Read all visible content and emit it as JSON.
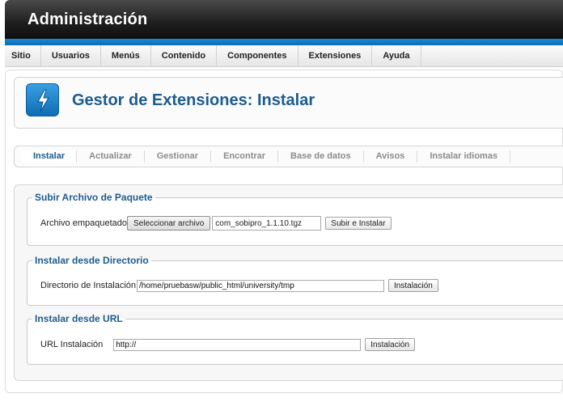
{
  "app": {
    "title": "Administración"
  },
  "menu": [
    "Sitio",
    "Usuarios",
    "Menús",
    "Contenido",
    "Componentes",
    "Extensiones",
    "Ayuda"
  ],
  "header": {
    "title": "Gestor de Extensiones: Instalar",
    "icon": "lightning-bolt-icon"
  },
  "tabs": {
    "active": "Instalar",
    "items": [
      "Instalar",
      "Actualizar",
      "Gestionar",
      "Encontrar",
      "Base de datos",
      "Avisos",
      "Instalar idiomas"
    ]
  },
  "upload": {
    "legend": "Subir Archivo de Paquete",
    "label": "Archivo empaquetado",
    "choose_button": "Seleccionar archivo",
    "file_name": "com_sobipro_1.1.10.tgz",
    "submit_button": "Subir e Instalar"
  },
  "directory": {
    "legend": "Instalar desde Directorio",
    "label": "Directorio de Instalación",
    "value": "/home/pruebasw/public_html/university/tmp",
    "button": "Instalación"
  },
  "url": {
    "legend": "Instalar desde URL",
    "label": "URL Instalación",
    "value": "http://",
    "button": "Instalación"
  },
  "colors": {
    "accent": "#1d5c8f",
    "bar_blue": "#1a8ad6"
  }
}
